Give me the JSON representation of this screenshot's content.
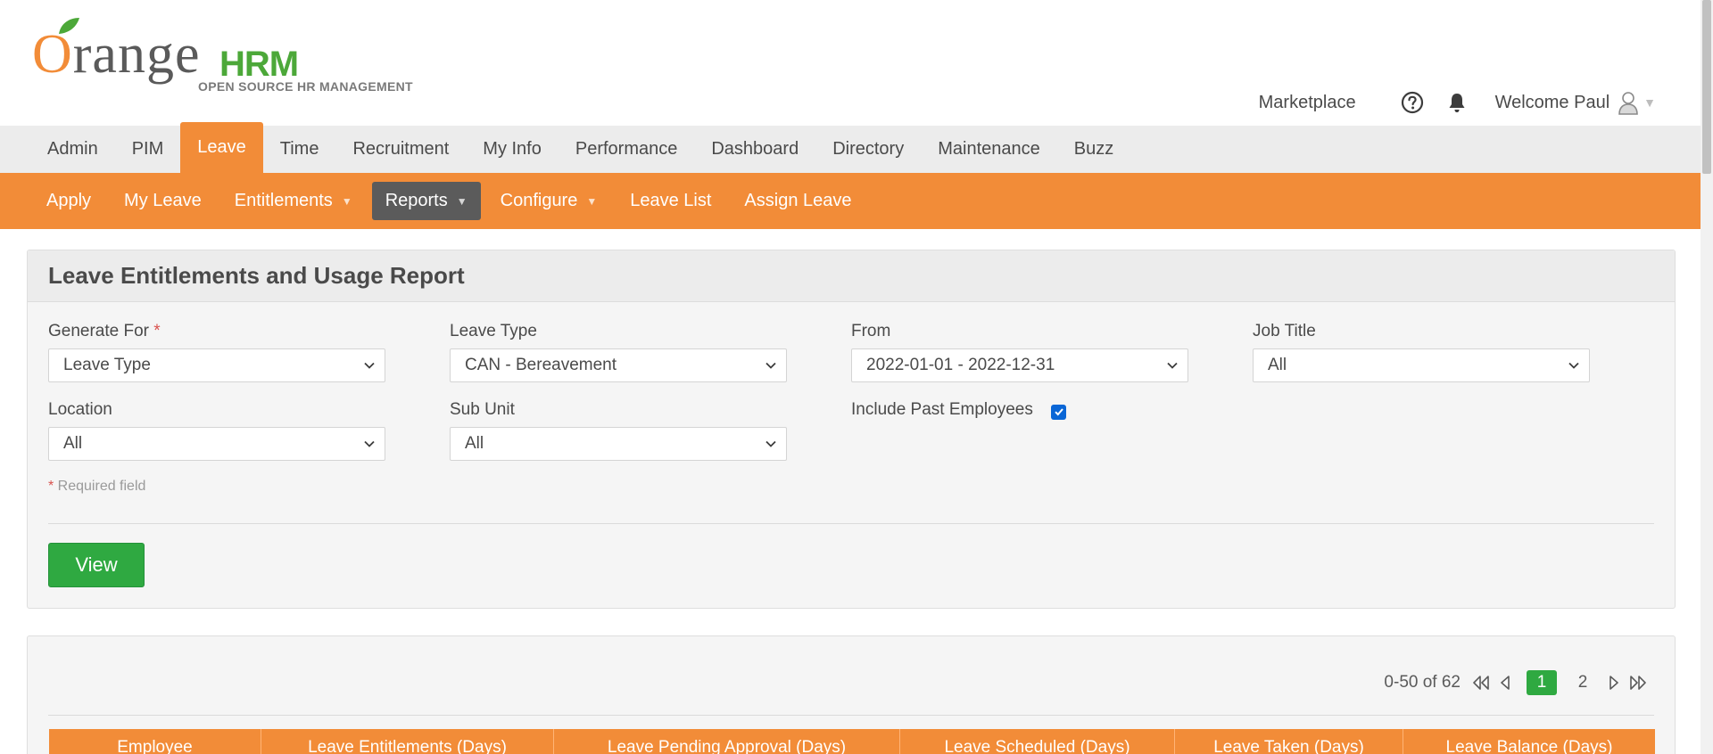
{
  "brand": {
    "logo_word": "range",
    "logo_letter": "O",
    "logo_hrm": "HRM",
    "logo_sub": "OPEN SOURCE HR MANAGEMENT",
    "accent": "#f28c38",
    "green": "#2fa941"
  },
  "header": {
    "marketplace": "Marketplace",
    "welcome": "Welcome Paul",
    "icons": [
      "help-icon",
      "bell-icon",
      "user-icon"
    ]
  },
  "mainnav": {
    "items": [
      "Admin",
      "PIM",
      "Leave",
      "Time",
      "Recruitment",
      "My Info",
      "Performance",
      "Dashboard",
      "Directory",
      "Maintenance",
      "Buzz"
    ],
    "active": "Leave"
  },
  "subnav": {
    "items": [
      {
        "label": "Apply"
      },
      {
        "label": "My Leave"
      },
      {
        "label": "Entitlements",
        "dropdown": true
      },
      {
        "label": "Reports",
        "dropdown": true,
        "active": true
      },
      {
        "label": "Configure",
        "dropdown": true
      },
      {
        "label": "Leave List"
      },
      {
        "label": "Assign Leave"
      }
    ]
  },
  "report": {
    "title": "Leave Entitlements and Usage Report",
    "generate_for": {
      "label": "Generate For",
      "value": "Leave Type",
      "required_mark": "*"
    },
    "leave_type": {
      "label": "Leave Type",
      "value": "CAN - Bereavement"
    },
    "from": {
      "label": "From",
      "value": "2022-01-01 - 2022-12-31"
    },
    "job_title": {
      "label": "Job Title",
      "value": "All"
    },
    "location": {
      "label": "Location",
      "value": "All"
    },
    "sub_unit": {
      "label": "Sub Unit",
      "value": "All"
    },
    "include_past": {
      "label": "Include Past Employees",
      "checked": true
    },
    "required_note_mark": "*",
    "required_note": " Required field",
    "view_button": "View"
  },
  "results": {
    "count": "0-50 of 62",
    "pages": [
      "1",
      "2"
    ],
    "current_page": "1",
    "columns": [
      "Employee",
      "Leave Entitlements (Days)",
      "Leave Pending Approval (Days)",
      "Leave Scheduled (Days)",
      "Leave Taken (Days)",
      "Leave Balance (Days)"
    ]
  }
}
